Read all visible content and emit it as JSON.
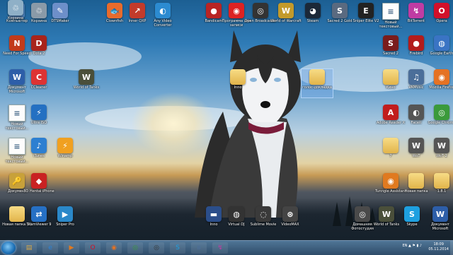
{
  "desktop": {
    "icons": [
      {
        "label": "Компьютер",
        "glyph": "▣",
        "color": "#4a7fb8"
      },
      {
        "label": "Корзина",
        "glyph": "♲",
        "color": "#8a9aa8"
      },
      {
        "label": "DTSMaker",
        "glyph": "✎",
        "color": "#6d8fc9"
      },
      {
        "label": "Clownfish",
        "glyph": "🐟",
        "color": "#e86b2c"
      },
      {
        "label": "Inner QXP",
        "glyph": "↗",
        "color": "#c23b2b"
      },
      {
        "label": "Any Video Converter",
        "glyph": "◐",
        "color": "#2c8bd1"
      },
      {
        "label": "Bandicam",
        "glyph": "●",
        "color": "#b92424"
      },
      {
        "label": "Программа для записи",
        "glyph": "◉",
        "color": "#d22"
      },
      {
        "label": "Open Broadcaster",
        "glyph": "◎",
        "color": "#333"
      },
      {
        "label": "World of Warcraft",
        "glyph": "W",
        "color": "#c39a2a"
      },
      {
        "label": "Steam",
        "glyph": "◕",
        "color": "#1b2838"
      },
      {
        "label": "Sacred 2 Gold",
        "glyph": "S",
        "color": "#5a6a80"
      },
      {
        "label": "Sniper Elite V2",
        "glyph": "E",
        "color": "#222"
      },
      {
        "label": "Новый текстовый...",
        "glyph": "≡",
        "color": "#fff"
      },
      {
        "label": "BitTorrent",
        "glyph": "↯",
        "color": "#c03ca3"
      },
      {
        "label": "Opera",
        "glyph": "O",
        "color": "#d2102a"
      },
      {
        "label": "Need For Speed",
        "glyph": "N",
        "color": "#c23b1b"
      },
      {
        "label": "Dota 2",
        "glyph": "D",
        "color": "#a8241c"
      },
      {
        "label": "Sacred 2",
        "glyph": "S",
        "color": "#7a1c1c"
      },
      {
        "label": "Firebird",
        "glyph": "●",
        "color": "#b31c1c"
      },
      {
        "label": "Google Earth",
        "glyph": "◍",
        "color": "#3a74c4"
      },
      {
        "label": "Документ Microsoft",
        "glyph": "W",
        "color": "#2d5ea8"
      },
      {
        "label": "CCleaner",
        "glyph": "C",
        "color": "#d33"
      },
      {
        "label": "World of Tanks",
        "glyph": "W",
        "color": "#4a4f3a"
      },
      {
        "label": "Inno",
        "glyph": "▭",
        "color": "#e2b44a"
      },
      {
        "label": "голос-докладка",
        "glyph": "▭",
        "color": "#e2b44a"
      },
      {
        "label": "Кино",
        "glyph": "▭",
        "color": "#e2b44a"
      },
      {
        "label": "VKMusic",
        "glyph": "♫",
        "color": "#4b6e99"
      },
      {
        "label": "Mozilla Firefox",
        "glyph": "◉",
        "color": "#e57223"
      },
      {
        "label": "Новый текстовый...",
        "glyph": "≡",
        "color": "#fff"
      },
      {
        "label": "Ultra ISO",
        "glyph": "⚡",
        "color": "#2470c2"
      },
      {
        "label": "Adobe Reader X",
        "glyph": "A",
        "color": "#c11d1d"
      },
      {
        "label": "Faceit",
        "glyph": "◐",
        "color": "#555"
      },
      {
        "label": "Google Chrome",
        "glyph": "◎",
        "color": "#3b9a3b"
      },
      {
        "label": "Новый текстовый...",
        "glyph": "≡",
        "color": "#fff"
      },
      {
        "label": "iTunes",
        "glyph": "♪",
        "color": "#2d7fd1"
      },
      {
        "label": "Winamp",
        "glyph": "⚡",
        "color": "#f0a020"
      },
      {
        "label": "7",
        "glyph": "▭",
        "color": "#9cc"
      },
      {
        "label": "WoT",
        "glyph": "W",
        "color": "#555"
      },
      {
        "label": "WoT 2",
        "glyph": "W",
        "color": "#555"
      },
      {
        "label": "Документ",
        "glyph": "🔑",
        "color": "#c8a13a"
      },
      {
        "label": "3D Hentai iPhone",
        "glyph": "◆",
        "color": "#c92222"
      },
      {
        "label": "Tunngle Assistant",
        "glyph": "◉",
        "color": "#e07a20"
      },
      {
        "label": "Новая папка",
        "glyph": "▭",
        "color": "#e2b44a"
      },
      {
        "label": "1.8.1",
        "glyph": "▭",
        "color": "#e2b44a"
      },
      {
        "label": "Новая папка (2)",
        "glyph": "▭",
        "color": "#e2b44a"
      },
      {
        "label": "TeamViewer 9",
        "glyph": "⇄",
        "color": "#2670c4"
      },
      {
        "label": "Sniper Pro",
        "glyph": "▶",
        "color": "#2a88c9"
      },
      {
        "label": "Inno",
        "glyph": "▬",
        "color": "#2b4e8a"
      },
      {
        "label": "Virtual DJ",
        "glyph": "◍",
        "color": "#333"
      },
      {
        "label": "Sublime Movie",
        "glyph": "◌",
        "color": "#3a3a3a"
      },
      {
        "label": "VideoMAX",
        "glyph": "⊛",
        "color": "#444"
      },
      {
        "label": "Домашняя Фотостудия",
        "glyph": "◎",
        "color": "#4a4a4a"
      },
      {
        "label": "World of Tanks",
        "glyph": "W",
        "color": "#4a4f3a"
      },
      {
        "label": "Skype",
        "glyph": "S",
        "color": "#1ea0e0"
      },
      {
        "label": "Документ Microsoft",
        "glyph": "W",
        "color": "#2d5ea8"
      },
      {
        "label": "Корзина",
        "glyph": "♲",
        "color": "#8fb0c7"
      }
    ]
  },
  "taskbar": {
    "pinned": [
      {
        "name": "explorer",
        "glyph": "▤",
        "color": "#d9a948"
      },
      {
        "name": "internet-explorer",
        "glyph": "e",
        "color": "#2a82d8"
      },
      {
        "name": "media-player",
        "glyph": "▶",
        "color": "#e07a20"
      },
      {
        "name": "opera",
        "glyph": "O",
        "color": "#d2102a"
      },
      {
        "name": "firefox",
        "glyph": "◉",
        "color": "#e57223"
      },
      {
        "name": "chrome",
        "glyph": "◎",
        "color": "#3b9a3b"
      },
      {
        "name": "obs",
        "glyph": "◎",
        "color": "#333"
      },
      {
        "name": "skype",
        "glyph": "S",
        "color": "#1ea0e0"
      },
      {
        "name": "vk",
        "glyph": "в",
        "color": "#4b6e99"
      },
      {
        "name": "bittorrent",
        "glyph": "↯",
        "color": "#c03ca3"
      }
    ],
    "tray": {
      "lang": "EN",
      "icons": "▲ ⚑ ▮ ♪"
    },
    "clock": {
      "time": "18:09",
      "date": "05.11.2014"
    }
  }
}
